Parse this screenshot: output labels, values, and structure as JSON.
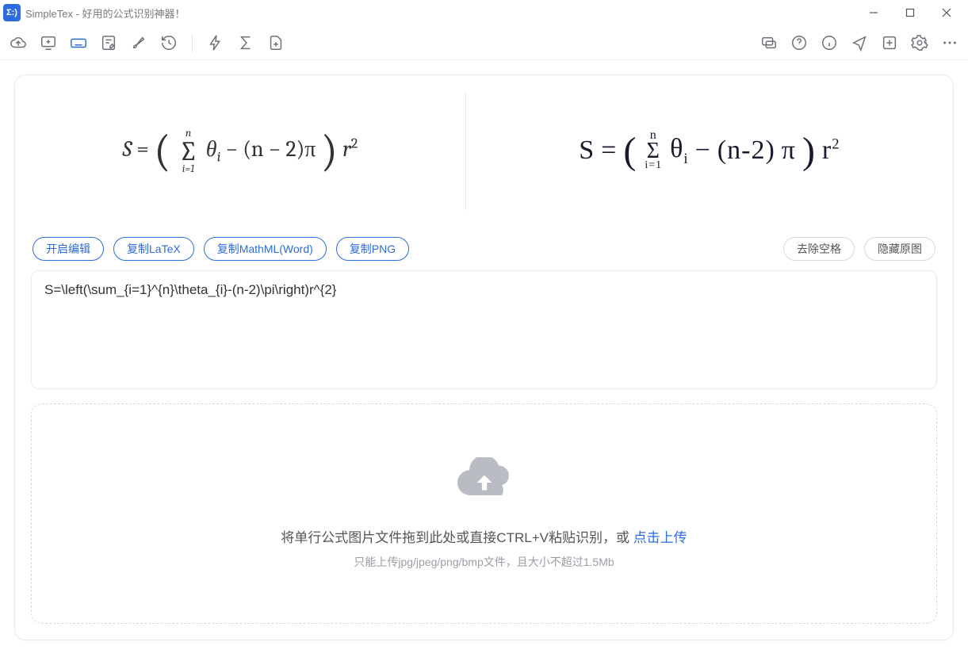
{
  "window": {
    "title": "SimpleTex - 好用的公式识别神器！"
  },
  "actions": {
    "edit": "开启编辑",
    "copy_latex": "复制LaTeX",
    "copy_mathml": "复制MathML(Word)",
    "copy_png": "复制PNG",
    "remove_spaces": "去除空格",
    "hide_original": "隐藏原图"
  },
  "latex_output": "S=\\left(\\sum_{i=1}^{n}\\theta_{i}-(n-2)\\pi\\right)r^{2}",
  "upload": {
    "line1_prefix": "将单行公式图片文件拖到此处或直接CTRL+V粘贴识别，或 ",
    "line1_link": "点击上传",
    "line2": "只能上传jpg/jpeg/png/bmp文件，且大小不超过1.5Mb"
  },
  "formula": {
    "sum_upper": "n",
    "sum_lower": "i=1",
    "theta_sub": "i",
    "minus_part": "(n − 2)π",
    "r_sup": "2",
    "hw_text": "S = ( Σ θᵢ − (n-2) π ) r²"
  }
}
